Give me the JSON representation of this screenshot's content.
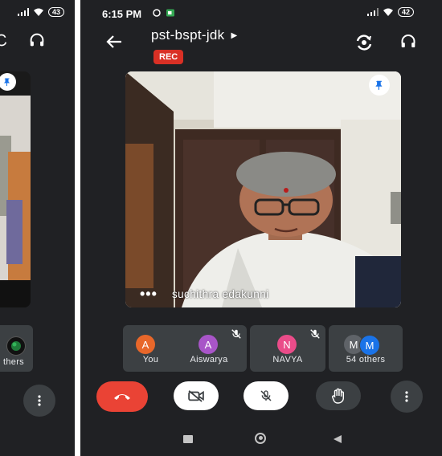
{
  "status_bar": {
    "time": "6:15 PM",
    "battery": "42"
  },
  "left_status_bar": {
    "battery": "43"
  },
  "header": {
    "meeting_code": "pst-bspt-jdk",
    "rec_badge": "REC"
  },
  "main_video": {
    "participant_name": "suchithra edakunni"
  },
  "participants": [
    {
      "initial": "A",
      "name": "You",
      "color": "#e8672a"
    },
    {
      "initial": "A",
      "name": "Aiswarya",
      "color": "#a855c8"
    },
    {
      "initial": "N",
      "name": "NAVYA",
      "color": "#ea4c89"
    }
  ],
  "others_tile": {
    "initials": [
      "M",
      "M"
    ],
    "colors": [
      "#5f6368",
      "#1a73e8"
    ],
    "label": "54 others"
  },
  "left_phone": {
    "others_label": "thers"
  },
  "colors": {
    "background": "#202124",
    "tile": "#3c4043",
    "end_call": "#ea4335",
    "rec": "#d93025"
  }
}
